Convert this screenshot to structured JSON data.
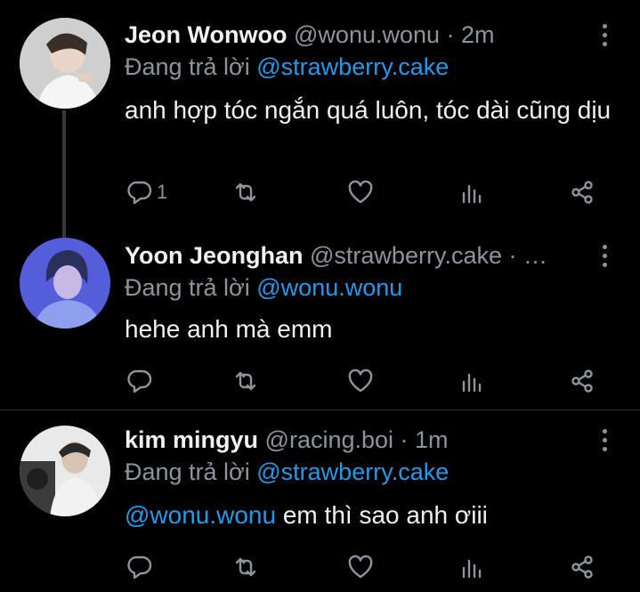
{
  "tweets": [
    {
      "name": "Jeon Wonwoo",
      "handle": "@wonu.wonu",
      "sep": " · ",
      "time": "2m",
      "reply_prefix": "Đang trả lời ",
      "reply_to": "@strawberry.cake",
      "body_mention": "",
      "body": "anh hợp tóc ngắn quá luôn, tóc dài cũng dịu",
      "reply_count": "1"
    },
    {
      "name": "Yoon Jeonghan",
      "handle": "@strawberry.cake",
      "sep": " · ",
      "time": "…",
      "reply_prefix": "Đang trả lời ",
      "reply_to": "@wonu.wonu",
      "body_mention": "",
      "body": "hehe anh mà emm",
      "reply_count": ""
    },
    {
      "name": "kim mingyu",
      "handle": "@racing.boi",
      "sep": " · ",
      "time": "1m",
      "reply_prefix": "Đang trả lời ",
      "reply_to": "@strawberry.cake",
      "body_mention": "@wonu.wonu",
      "body": " em thì sao anh ơiii",
      "reply_count": ""
    }
  ],
  "icons": [
    "reply-icon",
    "retweet-icon",
    "like-icon",
    "analytics-icon",
    "share-icon",
    "more-icon"
  ],
  "colors": {
    "background": "#000000",
    "accent": "#1d9bf0",
    "muted": "#8b959c",
    "text": "#e7e9ea"
  }
}
